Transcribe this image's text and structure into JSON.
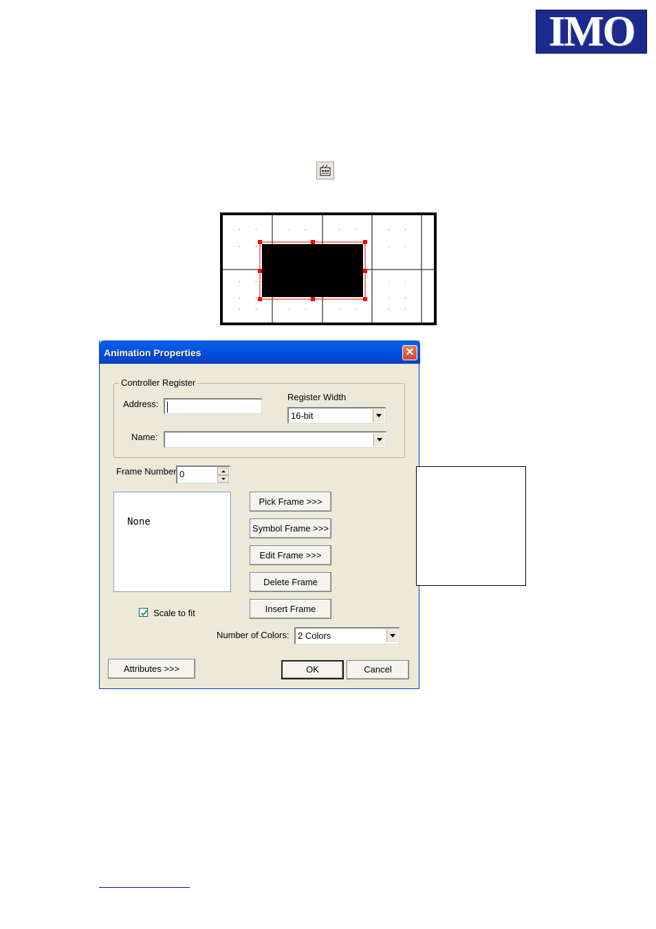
{
  "logo": {
    "text": "IMO",
    "bg": "#1b2a8c"
  },
  "toolbar_icon": {
    "icon": "animation-icon"
  },
  "canvas_preview": {
    "grid_color": "#000000",
    "selection_color": "#ff0000",
    "fill_color": "#000000"
  },
  "dialog": {
    "title": "Animation Properties",
    "close_label": "✕",
    "controller_register": {
      "group_label": "Controller Register",
      "address_label": "Address:",
      "address_value": "",
      "register_width_label": "Register Width",
      "register_width_value": "16-bit",
      "name_label": "Name:",
      "name_value": ""
    },
    "frame_number_label": "Frame Number:",
    "frame_number_value": "0",
    "frames_list": [
      "None"
    ],
    "buttons": {
      "pick_frame": "Pick Frame >>>",
      "symbol_frame": "Symbol Frame >>>",
      "edit_frame": "Edit Frame >>>",
      "delete_frame": "Delete Frame",
      "insert_frame": "Insert Frame",
      "attributes": "Attributes >>>",
      "ok": "OK",
      "cancel": "Cancel"
    },
    "scale_to_fit_label": "Scale to fit",
    "scale_to_fit_checked": true,
    "number_of_colors_label": "Number of Colors:",
    "number_of_colors_value": "2 Colors"
  },
  "colors": {
    "title_bar": "#0454e3",
    "dialog_bg": "#ece9d8",
    "close_button": "#d2472a"
  }
}
